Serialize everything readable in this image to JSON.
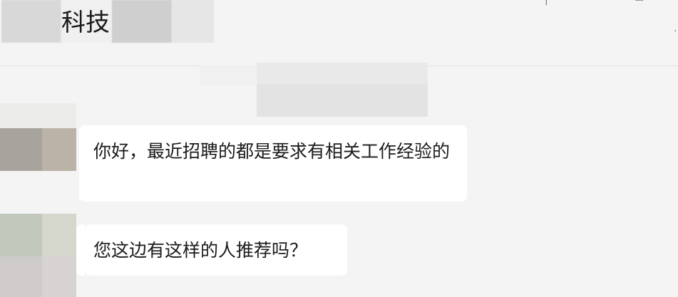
{
  "header": {
    "title": "科技",
    "icon_right_1": "more-icon",
    "icon_right_2": "window-icon"
  },
  "messages": [
    {
      "text": "你好，最近招聘的都是要求有相关工作经验的"
    },
    {
      "text": "您这边有这样的人推荐吗？"
    }
  ]
}
